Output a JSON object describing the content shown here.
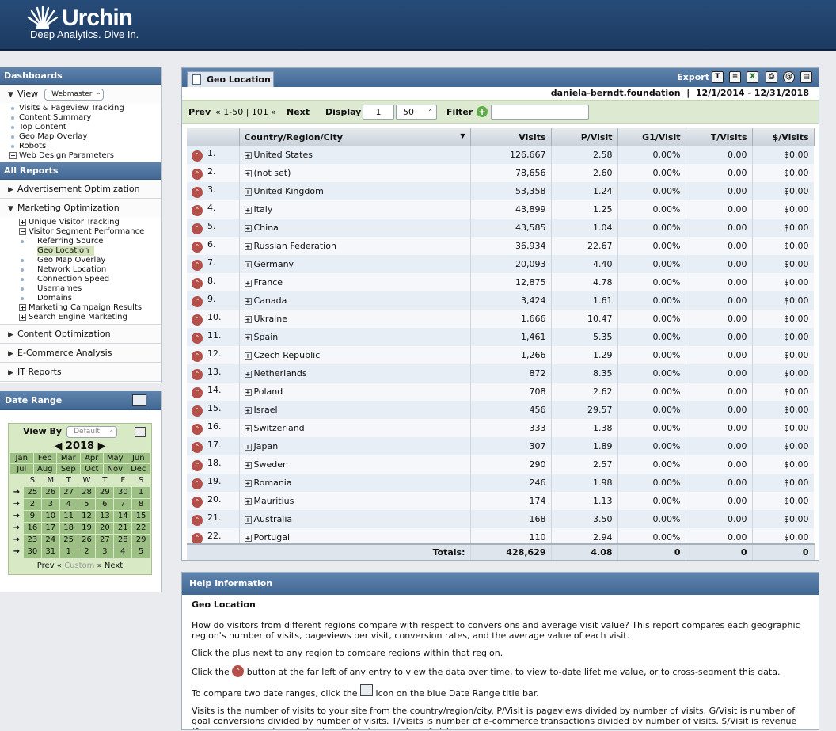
{
  "brand": {
    "name": "Urchin",
    "tagline": "Deep Analytics. Dive In."
  },
  "sidebar": {
    "dashboards_title": "Dashboards",
    "view_label": "View",
    "view_value": "Webmaster",
    "dash_items": [
      "Visits & Pageview Tracking",
      "Content Summary",
      "Top Content",
      "Geo Map Overlay",
      "Robots"
    ],
    "web_design": "Web Design Parameters",
    "all_reports": "All Reports",
    "adv": "Advertisement Optimization",
    "mkt": "Marketing Optimization",
    "uvt": "Unique Visitor Tracking",
    "vsp": "Visitor Segment Performance",
    "vsp_items": [
      "Referring Source",
      "Geo Location",
      "Geo Map Overlay",
      "Network Location",
      "Connection Speed",
      "Usernames",
      "Domains"
    ],
    "mcr": "Marketing Campaign Results",
    "sem": "Search Engine Marketing",
    "content": "Content Optimization",
    "ecom": "E-Commerce Analysis",
    "it": "IT Reports"
  },
  "daterange": {
    "title": "Date Range",
    "viewby": "View By",
    "viewby_value": "Default",
    "year": "2018",
    "months": [
      "Jan",
      "Feb",
      "Mar",
      "Apr",
      "May",
      "Jun",
      "Jul",
      "Aug",
      "Sep",
      "Oct",
      "Nov",
      "Dec"
    ],
    "dow": [
      "S",
      "M",
      "T",
      "W",
      "T",
      "F",
      "S"
    ],
    "weeks": [
      [
        "25",
        "26",
        "27",
        "28",
        "29",
        "30",
        "1"
      ],
      [
        "2",
        "3",
        "4",
        "5",
        "6",
        "7",
        "8"
      ],
      [
        "9",
        "10",
        "11",
        "12",
        "13",
        "14",
        "15"
      ],
      [
        "16",
        "17",
        "18",
        "19",
        "20",
        "21",
        "22"
      ],
      [
        "23",
        "24",
        "25",
        "26",
        "27",
        "28",
        "29"
      ],
      [
        "30",
        "31",
        "1",
        "2",
        "3",
        "4",
        "5"
      ]
    ],
    "prev": "Prev",
    "custom": "Custom",
    "next": "Next"
  },
  "report": {
    "tab": "Geo Location",
    "export": "Export",
    "site": "daniela-berndt.foundation",
    "range": "12/1/2014 - 12/31/2018",
    "prev": "Prev",
    "page_range": "1-50",
    "page_total": "101",
    "next": "Next",
    "display": "Display",
    "display_start": "1",
    "display_count": "50",
    "filter": "Filter",
    "columns": [
      "Country/Region/City",
      "Visits",
      "P/Visit",
      "G1/Visit",
      "T/Visits",
      "$/Visits"
    ],
    "rows": [
      [
        "1.",
        "United States",
        "126,667",
        "2.58",
        "0.00%",
        "0.00",
        "$0.00"
      ],
      [
        "2.",
        "(not set)",
        "78,656",
        "2.60",
        "0.00%",
        "0.00",
        "$0.00"
      ],
      [
        "3.",
        "United Kingdom",
        "53,358",
        "1.24",
        "0.00%",
        "0.00",
        "$0.00"
      ],
      [
        "4.",
        "Italy",
        "43,899",
        "1.25",
        "0.00%",
        "0.00",
        "$0.00"
      ],
      [
        "5.",
        "China",
        "43,585",
        "1.04",
        "0.00%",
        "0.00",
        "$0.00"
      ],
      [
        "6.",
        "Russian Federation",
        "36,934",
        "22.67",
        "0.00%",
        "0.00",
        "$0.00"
      ],
      [
        "7.",
        "Germany",
        "20,093",
        "4.40",
        "0.00%",
        "0.00",
        "$0.00"
      ],
      [
        "8.",
        "France",
        "12,875",
        "4.78",
        "0.00%",
        "0.00",
        "$0.00"
      ],
      [
        "9.",
        "Canada",
        "3,424",
        "1.61",
        "0.00%",
        "0.00",
        "$0.00"
      ],
      [
        "10.",
        "Ukraine",
        "1,666",
        "10.47",
        "0.00%",
        "0.00",
        "$0.00"
      ],
      [
        "11.",
        "Spain",
        "1,461",
        "5.35",
        "0.00%",
        "0.00",
        "$0.00"
      ],
      [
        "12.",
        "Czech Republic",
        "1,266",
        "1.29",
        "0.00%",
        "0.00",
        "$0.00"
      ],
      [
        "13.",
        "Netherlands",
        "872",
        "8.35",
        "0.00%",
        "0.00",
        "$0.00"
      ],
      [
        "14.",
        "Poland",
        "708",
        "2.62",
        "0.00%",
        "0.00",
        "$0.00"
      ],
      [
        "15.",
        "Israel",
        "456",
        "29.57",
        "0.00%",
        "0.00",
        "$0.00"
      ],
      [
        "16.",
        "Switzerland",
        "333",
        "1.38",
        "0.00%",
        "0.00",
        "$0.00"
      ],
      [
        "17.",
        "Japan",
        "307",
        "1.89",
        "0.00%",
        "0.00",
        "$0.00"
      ],
      [
        "18.",
        "Sweden",
        "290",
        "2.57",
        "0.00%",
        "0.00",
        "$0.00"
      ],
      [
        "19.",
        "Romania",
        "246",
        "1.98",
        "0.00%",
        "0.00",
        "$0.00"
      ],
      [
        "20.",
        "Mauritius",
        "174",
        "1.13",
        "0.00%",
        "0.00",
        "$0.00"
      ],
      [
        "21.",
        "Australia",
        "168",
        "3.50",
        "0.00%",
        "0.00",
        "$0.00"
      ],
      [
        "22.",
        "Portugal",
        "110",
        "2.94",
        "0.00%",
        "0.00",
        "$0.00"
      ]
    ],
    "totals": [
      "Totals:",
      "428,629",
      "4.08",
      "0",
      "0",
      "0"
    ]
  },
  "help": {
    "title": "Help Information",
    "subtitle": "Geo Location",
    "p1": "How do visitors from different regions compare with respect to conversions and average visit value? This report compares each geographic region's number of visits, pageviews per visit, conversion rates, and the average value of each visit.",
    "p2": "Click the plus next to any region to compare regions within that region.",
    "p3a": "Click the",
    "p3b": "button at the far left of any entry to view the data over time, to view to-date lifetime value, or to cross-segment this data.",
    "p4a": "To compare two date ranges, click the",
    "p4b": "icon on the blue Date Range title bar.",
    "p5": "Visits is the number of visits to your site from the country/region/city. P/Visit is pageviews divided by number of visits. G/Visit is number of goal conversions divided by number of visits. T/Visits is number of e-commerce transactions divided by number of visits. $/Visit is revenue (from e-commerce) or goal value divided by number of visits."
  }
}
